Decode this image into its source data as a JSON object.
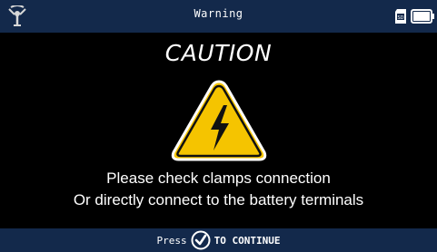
{
  "header": {
    "title": "Warning",
    "left_icon": "signal-icon",
    "right_icons": [
      "sd-card-icon",
      "battery-icon"
    ]
  },
  "main": {
    "heading": "CAUTION",
    "icon": "high-voltage-warning-icon",
    "message_line1": "Please check clamps connection",
    "message_line2": "Or directly connect to the battery terminals"
  },
  "footer": {
    "press_label": "Press",
    "button_icon": "checkmark-icon",
    "continue_label": "TO CONTINUE"
  },
  "colors": {
    "bar_background": "#13294b",
    "screen_background": "#000000",
    "warning_yellow": "#f5c400",
    "text": "#ffffff"
  }
}
